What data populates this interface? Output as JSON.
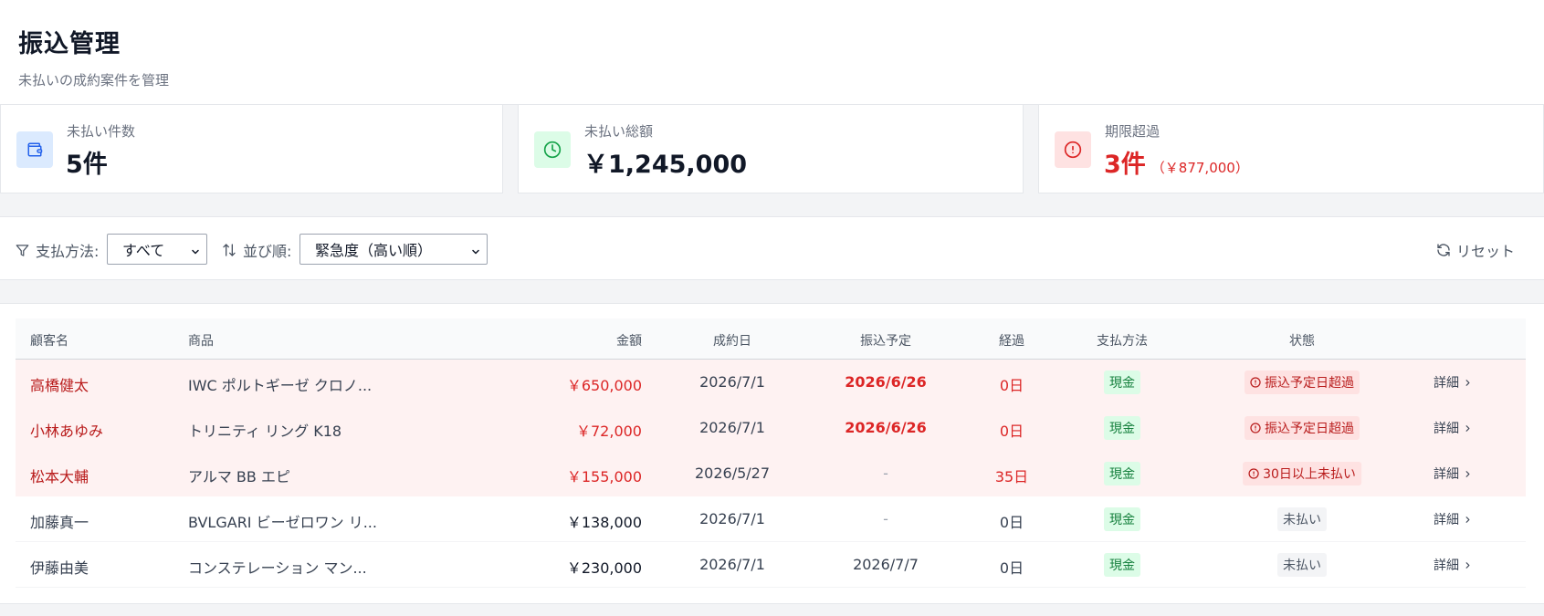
{
  "header": {
    "title": "振込管理",
    "subtitle": "未払いの成約案件を管理"
  },
  "stats": {
    "unpaid_count": {
      "label": "未払い件数",
      "value": "5件"
    },
    "unpaid_total": {
      "label": "未払い総額",
      "value": "￥1,245,000"
    },
    "overdue": {
      "label": "期限超過",
      "value": "3件",
      "sub": "（￥877,000）"
    }
  },
  "filters": {
    "payment_method": {
      "label": "支払方法:",
      "selected": "すべて"
    },
    "sort": {
      "label": "並び順:",
      "selected": "緊急度（高い順）"
    },
    "reset_label": "リセット"
  },
  "table": {
    "headers": {
      "customer": "顧客名",
      "product": "商品",
      "amount": "金額",
      "contract_date": "成約日",
      "due_date": "振込予定",
      "elapsed": "経過",
      "method": "支払方法",
      "status": "状態"
    },
    "rows": [
      {
        "customer": "高橋健太",
        "product": "IWC ポルトギーゼ クロノ...",
        "amount": "￥650,000",
        "contract_date": "2026/7/1",
        "due_date": "2026/6/26",
        "elapsed": "0日",
        "method": "現金",
        "status": "振込予定日超過",
        "detail": "詳細"
      },
      {
        "customer": "小林あゆみ",
        "product": "トリニティ リング K18",
        "amount": "￥72,000",
        "contract_date": "2026/7/1",
        "due_date": "2026/6/26",
        "elapsed": "0日",
        "method": "現金",
        "status": "振込予定日超過",
        "detail": "詳細"
      },
      {
        "customer": "松本大輔",
        "product": "アルマ BB エピ",
        "amount": "￥155,000",
        "contract_date": "2026/5/27",
        "due_date": "-",
        "elapsed": "35日",
        "method": "現金",
        "status": "30日以上未払い",
        "detail": "詳細"
      },
      {
        "customer": "加藤真一",
        "product": "BVLGARI ビーゼロワン リ...",
        "amount": "￥138,000",
        "contract_date": "2026/7/1",
        "due_date": "-",
        "elapsed": "0日",
        "method": "現金",
        "status": "未払い",
        "detail": "詳細"
      },
      {
        "customer": "伊藤由美",
        "product": "コンステレーション マン...",
        "amount": "￥230,000",
        "contract_date": "2026/7/1",
        "due_date": "2026/7/7",
        "elapsed": "0日",
        "method": "現金",
        "status": "未払い",
        "detail": "詳細"
      }
    ]
  },
  "colors": {
    "alert_row_bg": "#fef2f2",
    "danger": "#dc2626",
    "cash_badge_bg": "#dcfce7",
    "cash_badge_text": "#15803d"
  }
}
